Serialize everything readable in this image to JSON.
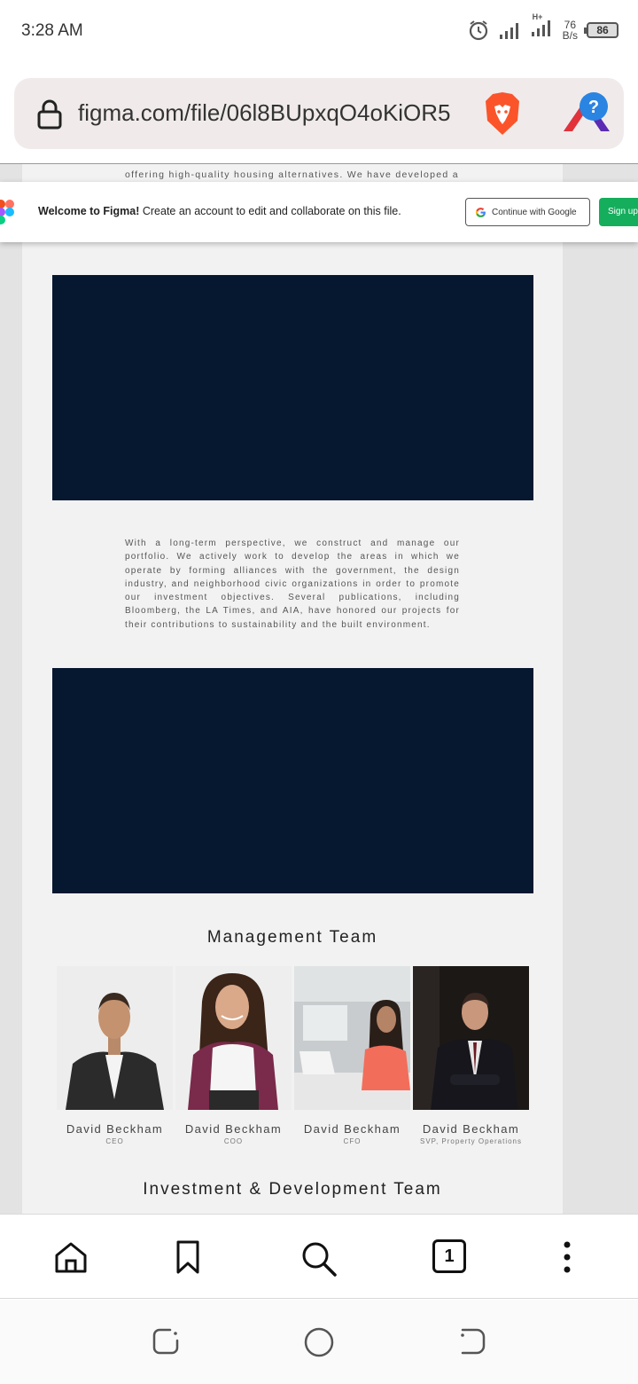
{
  "status": {
    "time": "3:28 AM",
    "net_speed_value": "76",
    "net_speed_unit": "B/s",
    "battery": "86",
    "network_type": "H+"
  },
  "browser": {
    "url": "figma.com/file/06l8BUpxqO4oKiOR5",
    "tab_count": "1"
  },
  "page": {
    "clipped_text": "offering high-quality housing alternatives. We have developed a",
    "about_text": "With a long-term perspective, we construct and manage our portfolio. We actively work to develop the areas in which we operate by forming alliances with the government, the design industry, and neighborhood civic organizations in order to promote our investment objectives. Several publications, including Bloomberg, the LA Times, and AIA, have honored our projects for their contributions to sustainability and the built environment.",
    "management_title": "Management Team",
    "investment_title": "Investment & Development Team",
    "team": [
      {
        "name": "David Beckham",
        "role": "CEO"
      },
      {
        "name": "David Beckham",
        "role": "COO"
      },
      {
        "name": "David Beckham",
        "role": "CFO"
      },
      {
        "name": "David Beckham",
        "role": "SVP, Property Operations"
      }
    ]
  },
  "figma_banner": {
    "welcome": "Welcome to Figma!",
    "message": "Create an account to edit and collaborate on this file.",
    "google_button": "Continue with Google",
    "signup_button": "Sign up"
  },
  "colors": {
    "dark_block": "#061730",
    "signup_green": "#14ae5c",
    "brave_orange": "#fb542b"
  }
}
